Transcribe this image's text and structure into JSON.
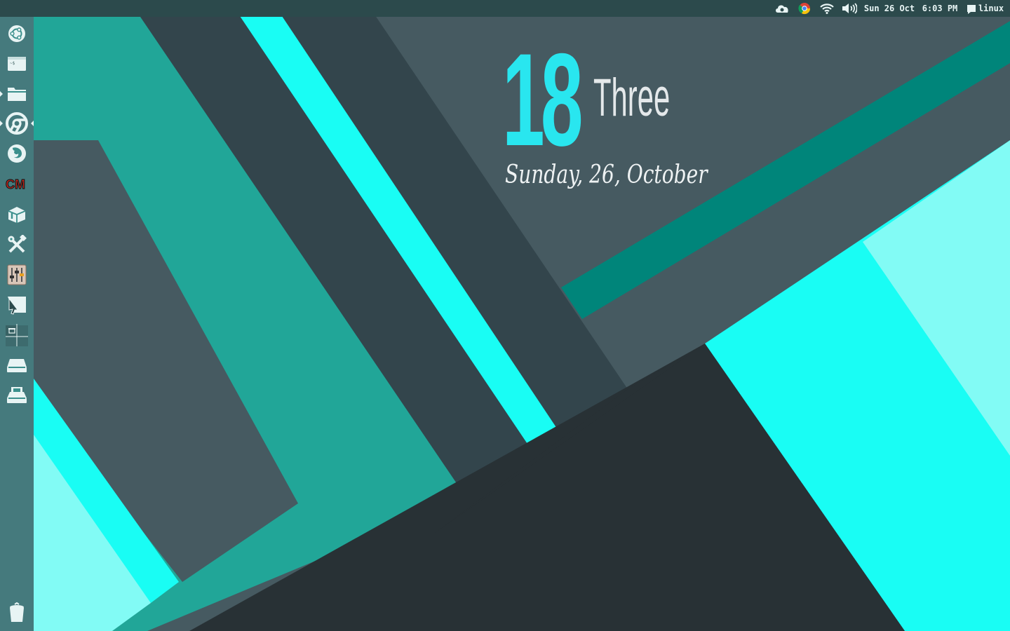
{
  "desktop": {
    "wallpaper_colors": {
      "cyan": "#19fdf4",
      "light_cyan": "#82fbf5",
      "teal": "#21a698",
      "dark_teal": "#00857a",
      "slate": "#465a61",
      "charcoal": "#33454c",
      "darkest": "#283135"
    }
  },
  "topbar": {
    "indicators": [
      "cloud-sync-icon",
      "chrome-icon",
      "wifi-icon",
      "volume-icon"
    ],
    "datetime": "Sun 26 Oct",
    "time": "6:03 PM",
    "user": "linux"
  },
  "launcher": {
    "items": [
      {
        "name": "dash-home",
        "icon": "ubuntu-logo-icon"
      },
      {
        "name": "terminal",
        "icon": "terminal-icon"
      },
      {
        "name": "files",
        "icon": "folder-icon",
        "running": true
      },
      {
        "name": "chrome",
        "icon": "chrome-icon",
        "running": true,
        "focused": true
      },
      {
        "name": "firefox",
        "icon": "firefox-icon"
      },
      {
        "name": "cm",
        "icon": "cm-logo-icon"
      },
      {
        "name": "software-center",
        "icon": "package-icon"
      },
      {
        "name": "system-tools",
        "icon": "tools-icon"
      },
      {
        "name": "mixer",
        "icon": "mixer-icon"
      },
      {
        "name": "drawing",
        "icon": "cursor-shape-icon"
      },
      {
        "name": "workspace-switcher",
        "icon": "workspaces-icon"
      },
      {
        "name": "drive",
        "icon": "drive-icon"
      },
      {
        "name": "removable-drive",
        "icon": "removable-drive-icon"
      },
      {
        "name": "trash",
        "icon": "trash-icon"
      }
    ]
  },
  "clock_widget": {
    "day_number": "18",
    "hour_word": "Three",
    "date_line": "Sunday, 26, October"
  }
}
